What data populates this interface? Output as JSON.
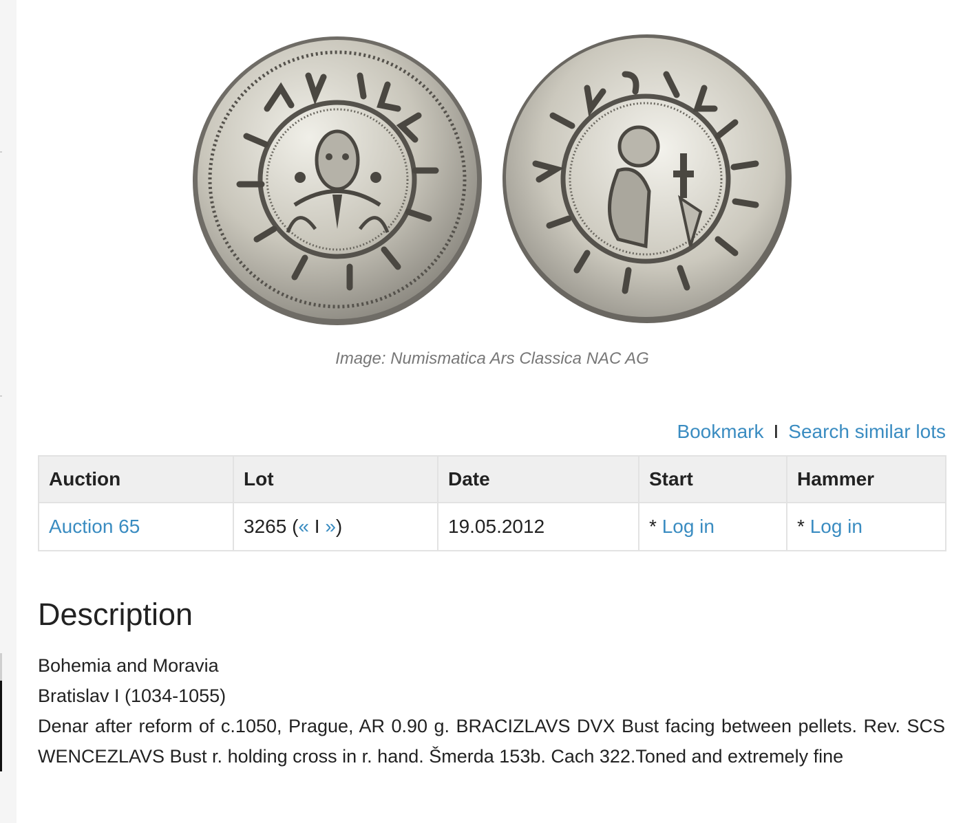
{
  "image_caption": "Image: Numismatica Ars Classica NAC AG",
  "actions": {
    "bookmark": "Bookmark",
    "separator": "I",
    "search_similar": "Search similar lots"
  },
  "table": {
    "headers": {
      "auction": "Auction",
      "lot": "Lot",
      "date": "Date",
      "start": "Start",
      "hammer": "Hammer"
    },
    "row": {
      "auction": "Auction 65",
      "lot_number": "3265 (",
      "lot_prev": "«",
      "lot_sep": " I ",
      "lot_next": "»",
      "lot_close": ")",
      "date": "19.05.2012",
      "start_prefix": "* ",
      "start_link": "Log in",
      "hammer_prefix": "* ",
      "hammer_link": "Log in"
    }
  },
  "description": {
    "title": "Description",
    "region": "Bohemia and Moravia",
    "ruler": "Bratislav I (1034-1055)",
    "text": "Denar after reform of c.1050, Prague, AR 0.90 g. BRACIZLAVS DVX Bust facing between pellets. Rev. SCS WENCEZLAVS Bust r. holding cross in r. hand. Šmerda 153b. Cach 322.Toned and extremely fine"
  },
  "colors": {
    "link": "#3a8cc1",
    "header_bg": "#efefef",
    "caption": "#777777"
  }
}
